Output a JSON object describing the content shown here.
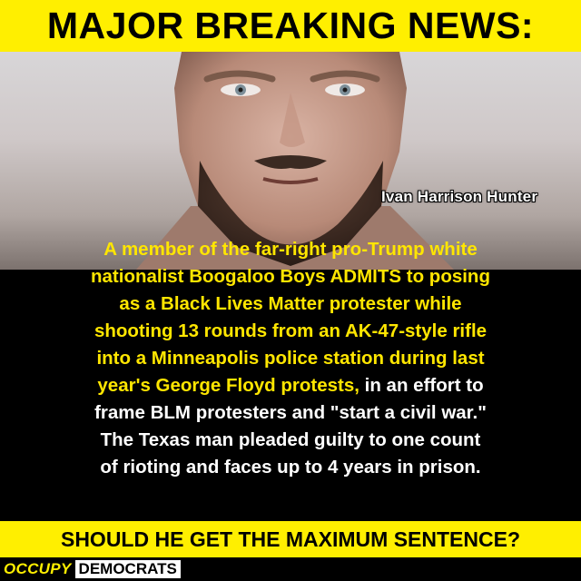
{
  "header": {
    "title": "MAJOR BREAKING NEWS:"
  },
  "photo": {
    "caption": "Ivan Harrison Hunter"
  },
  "story": {
    "lines": [
      [
        {
          "t": "A member of the far-right pro-Trump white",
          "y": true
        }
      ],
      [
        {
          "t": "nationalist Boogaloo Boys ADMITS to posing",
          "y": true
        }
      ],
      [
        {
          "t": "as a Black Lives Matter protester while",
          "y": true
        }
      ],
      [
        {
          "t": "shooting 13 rounds from an AK-47-style rifle",
          "y": true
        }
      ],
      [
        {
          "t": "into a Minneapolis police station during last",
          "y": true
        }
      ],
      [
        {
          "t": "year's George Floyd protests,",
          "y": true
        },
        {
          "t": " in an effort to",
          "y": false
        }
      ],
      [
        {
          "t": "frame BLM protesters and \"start a civil war.\"",
          "y": false
        }
      ],
      [
        {
          "t": "The Texas man pleaded guilty to one count",
          "y": false
        }
      ],
      [
        {
          "t": "of rioting and faces up to 4 years in prison.",
          "y": false
        }
      ]
    ]
  },
  "question": {
    "text": "SHOULD HE GET THE MAXIMUM SENTENCE?"
  },
  "brand": {
    "part1": "OCCUPY",
    "part2": "DEMOCRATS"
  },
  "colors": {
    "accent": "#ffef00",
    "highlight_text": "#ffe600",
    "background": "#000000"
  }
}
